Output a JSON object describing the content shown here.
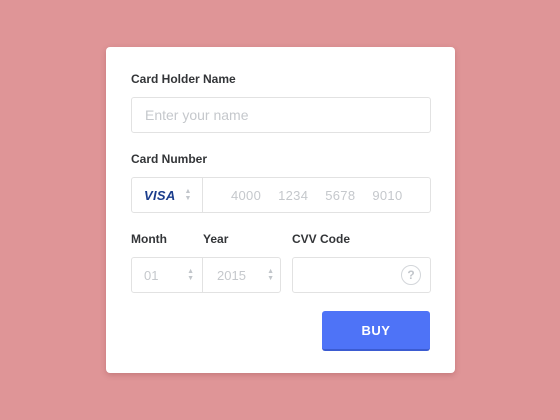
{
  "form": {
    "card_holder": {
      "label": "Card Holder Name",
      "placeholder": "Enter your name",
      "value": ""
    },
    "card_number": {
      "label": "Card Number",
      "brand": "VISA",
      "groups": [
        "4000",
        "1234",
        "5678",
        "9010"
      ]
    },
    "month": {
      "label": "Month",
      "value": "01"
    },
    "year": {
      "label": "Year",
      "value": "2015"
    },
    "cvv": {
      "label": "CVV Code",
      "value": "",
      "help_symbol": "?"
    },
    "buy_button": {
      "label": "BUY"
    }
  },
  "colors": {
    "background": "#df9597",
    "card": "#ffffff",
    "button": "#4e73f7",
    "brand_text": "#1a3c8c",
    "placeholder_text": "#c5c8cc"
  },
  "icons": [
    "stepper-icon",
    "help-icon"
  ]
}
